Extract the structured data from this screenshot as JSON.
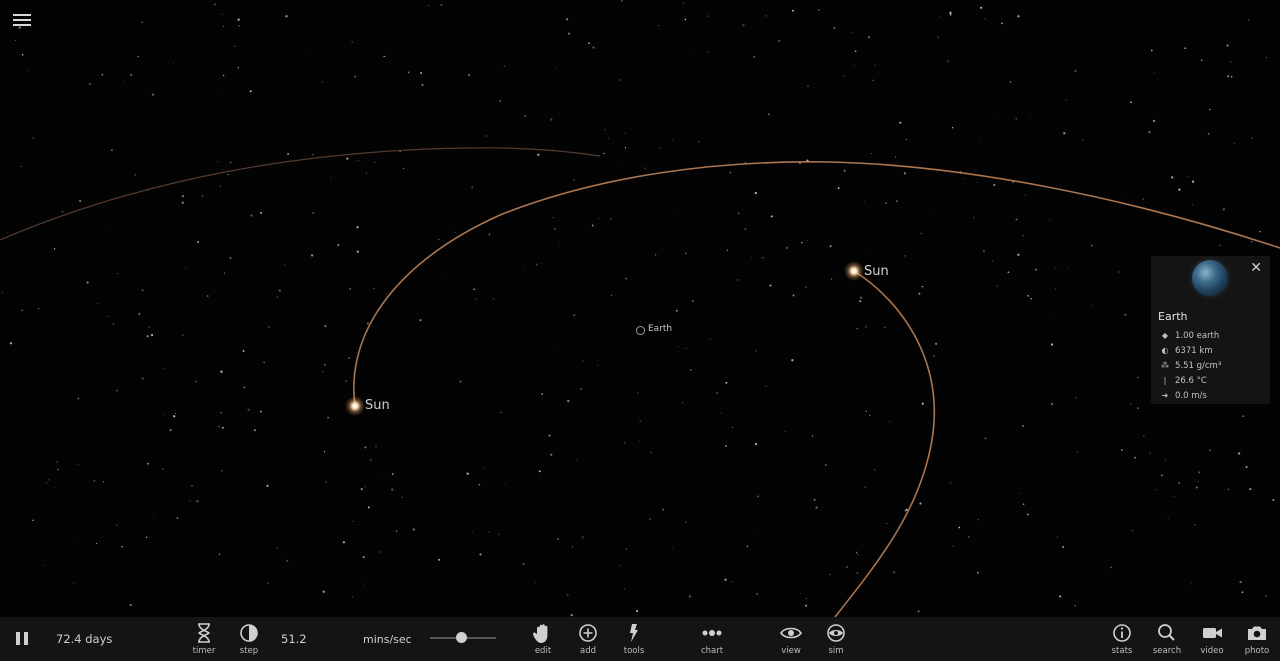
{
  "bodies": {
    "sun_left_label": "Sun",
    "sun_right_label": "Sun",
    "earth_label": "Earth"
  },
  "info_panel": {
    "title": "Earth",
    "close_symbol": "✕",
    "rows": [
      {
        "icon": "mass-icon",
        "value": "1.00 earth"
      },
      {
        "icon": "radius-icon",
        "value": "6371 km"
      },
      {
        "icon": "density-icon",
        "value": "5.51 g/cm³"
      },
      {
        "icon": "temperature-icon",
        "value": "26.6 °C"
      },
      {
        "icon": "speed-icon",
        "value": "0.0 m/s"
      }
    ]
  },
  "bottom_bar": {
    "elapsed": "72.4 days",
    "speed_value": "51.2",
    "speed_unit": "mins/sec",
    "speed_slider_fraction": 0.48,
    "tools": {
      "timer": "timer",
      "step": "step",
      "edit": "edit",
      "add": "add",
      "tools": "tools",
      "chart": "chart",
      "view": "view",
      "sim": "sim",
      "stats": "stats",
      "search": "search",
      "video": "video",
      "photo": "photo"
    }
  },
  "colors": {
    "orbit_trail": "#c98a5a",
    "background": "#030303",
    "bar": "#141414"
  }
}
